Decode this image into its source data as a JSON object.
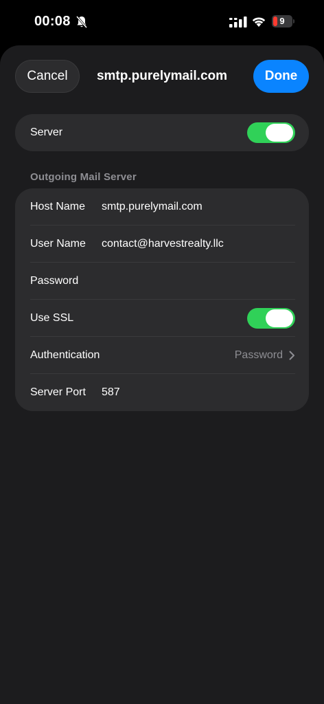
{
  "status_bar": {
    "time": "00:08",
    "battery_level": "9",
    "battery_color": "#ff3b30",
    "icons": [
      "bell-slash-icon",
      "signal-icon",
      "wifi-icon",
      "battery-icon"
    ]
  },
  "nav": {
    "cancel_label": "Cancel",
    "title": "smtp.purelymail.com",
    "done_label": "Done",
    "done_color": "#0a84ff"
  },
  "server_card": {
    "label": "Server",
    "enabled": true
  },
  "outgoing": {
    "header": "Outgoing Mail Server",
    "rows": [
      {
        "label": "Host Name",
        "value": "smtp.purelymail.com"
      },
      {
        "label": "User Name",
        "value": "contact@harvestrealty.llc"
      },
      {
        "label": "Password",
        "value": ""
      },
      {
        "label": "Use SSL",
        "value": "",
        "toggle": true
      },
      {
        "label": "Authentication",
        "value": "Password",
        "chevron": true
      },
      {
        "label": "Server Port",
        "value": "587"
      }
    ]
  },
  "toggle_color": "#30d158"
}
